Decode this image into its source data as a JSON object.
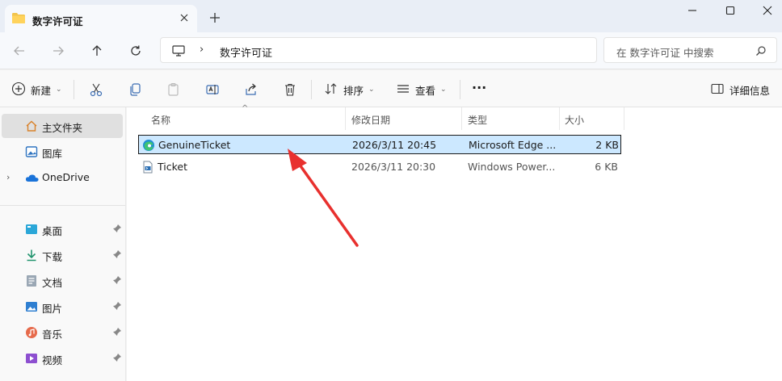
{
  "window": {
    "tab_title": "数字许可证",
    "new_tab": "+",
    "minimize": "minimize",
    "maximize": "maximize",
    "close": "close"
  },
  "address": {
    "separator": "›",
    "path": "数字许可证",
    "search_placeholder": "在 数字许可证 中搜索"
  },
  "toolbar": {
    "new_label": "新建",
    "sort_label": "排序",
    "view_label": "查看",
    "more_label": "···",
    "details_label": "详细信息"
  },
  "sidebar": {
    "items": [
      {
        "label": "主文件夹",
        "icon": "home-icon"
      },
      {
        "label": "图库",
        "icon": "gallery-icon"
      },
      {
        "label": "OneDrive",
        "icon": "cloud-icon"
      },
      {
        "label": "桌面",
        "icon": "desktop-icon"
      },
      {
        "label": "下载",
        "icon": "download-icon"
      },
      {
        "label": "文档",
        "icon": "document-icon"
      },
      {
        "label": "图片",
        "icon": "pictures-icon"
      },
      {
        "label": "音乐",
        "icon": "music-icon"
      },
      {
        "label": "视频",
        "icon": "video-icon"
      }
    ]
  },
  "table": {
    "columns": [
      "名称",
      "修改日期",
      "类型",
      "大小"
    ],
    "rows": [
      {
        "name": "GenuineTicket",
        "date": "2026/3/11 20:45",
        "type": "Microsoft Edge ...",
        "size": "2 KB",
        "icon": "edge-icon"
      },
      {
        "name": "Ticket",
        "date": "2026/3/11 20:30",
        "type": "Windows Power...",
        "size": "6 KB",
        "icon": "script-file-icon"
      }
    ]
  },
  "colors": {
    "accent": "#0067c0",
    "selection": "#cce8ff",
    "arrow": "#e8302e"
  }
}
